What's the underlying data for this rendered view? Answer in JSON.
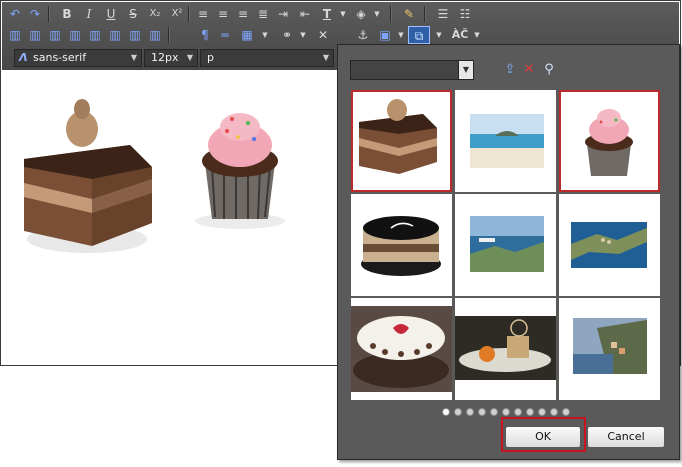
{
  "toolbar": {
    "font_family": "sans-serif",
    "font_size": "12px",
    "block_format": "p",
    "row1_icons": [
      "undo-icon",
      "redo-icon",
      "bold-icon",
      "italic-icon",
      "underline-icon",
      "strikethrough-icon",
      "subscript-icon",
      "superscript-icon",
      "align-left-icon",
      "align-center-icon",
      "align-right-icon",
      "align-justify-icon",
      "indent-icon",
      "text-color-icon",
      "highlight-icon",
      "clear-format-icon",
      "numbered-list-icon",
      "bullet-list-icon"
    ],
    "row1_glyphs": {
      "bold": "B",
      "italic": "I",
      "underline": "U",
      "strikethrough": "S",
      "subscript": "X₂",
      "superscript": "X²"
    },
    "spellcheck_glyph": "ÀČ"
  },
  "dialog": {
    "search_value": "",
    "ok_label": "OK",
    "cancel_label": "Cancel",
    "page_count": 11,
    "current_page": 1,
    "thumbnails": [
      {
        "name": "chocolate-cake",
        "selected": true
      },
      {
        "name": "beach-photo",
        "selected": false
      },
      {
        "name": "pink-cupcake",
        "selected": true
      },
      {
        "name": "round-mousse-cake",
        "selected": false
      },
      {
        "name": "harbor-photo",
        "selected": false
      },
      {
        "name": "coastal-village-photo",
        "selected": false
      },
      {
        "name": "decorated-cake",
        "selected": false
      },
      {
        "name": "dessert-plate",
        "selected": false
      },
      {
        "name": "cliff-town-photo",
        "selected": false
      }
    ]
  },
  "colors": {
    "accent_red": "#c4161c",
    "toolbar_bg": "#515151",
    "dialog_bg": "#5a5a5a"
  }
}
